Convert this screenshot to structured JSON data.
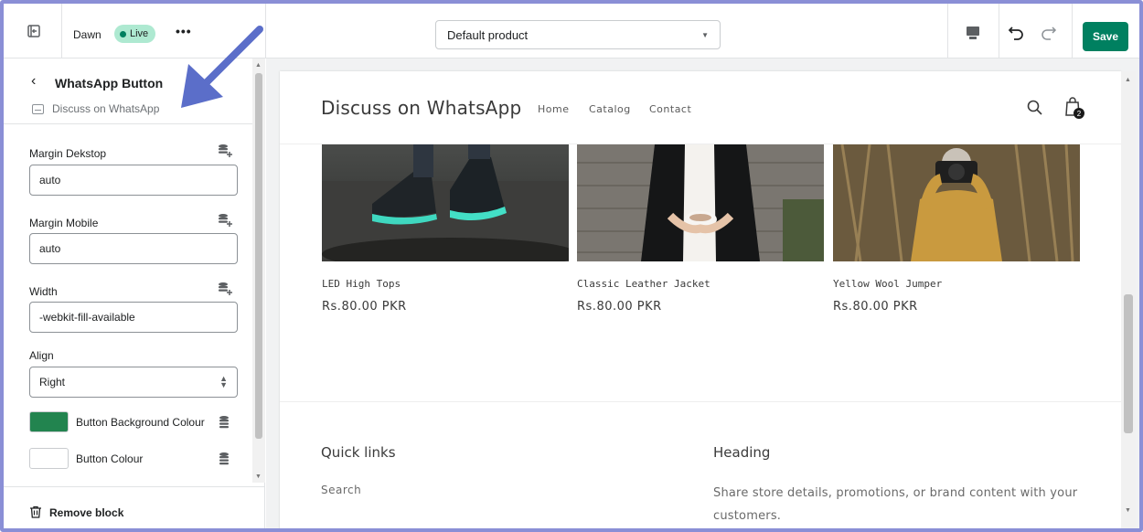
{
  "topbar": {
    "theme_name": "Dawn",
    "status_badge": "Live",
    "more_label": "•••",
    "template_select": "Default product",
    "save_label": "Save"
  },
  "sidebar": {
    "block_title": "WhatsApp Button",
    "block_subtitle": "Discuss on WhatsApp",
    "fields": {
      "margin_desktop": {
        "label": "Margin Dekstop",
        "value": "auto"
      },
      "margin_mobile": {
        "label": "Margin Mobile",
        "value": "auto"
      },
      "width": {
        "label": "Width",
        "value": "-webkit-fill-available"
      },
      "align": {
        "label": "Align",
        "value": "Right"
      },
      "button_background_colour": {
        "label": "Button Background Colour",
        "color": "#22844f"
      },
      "button_colour": {
        "label": "Button Colour",
        "color": "#ffffff"
      }
    },
    "remove_label": "Remove block"
  },
  "preview": {
    "store_name": "Discuss on WhatsApp",
    "nav": [
      "Home",
      "Catalog",
      "Contact"
    ],
    "cart_count": "2",
    "products": [
      {
        "title": "LED High Tops",
        "price": "Rs.80.00 PKR"
      },
      {
        "title": "Classic Leather Jacket",
        "price": "Rs.80.00 PKR"
      },
      {
        "title": "Yellow Wool Jumper",
        "price": "Rs.80.00 PKR"
      }
    ],
    "footer": {
      "quick_links_heading": "Quick links",
      "quick_links": [
        "Search"
      ],
      "heading": "Heading",
      "text": "Share store details, promotions, or brand content with your customers."
    }
  },
  "colors": {
    "accent_green": "#008060",
    "live_badge_bg": "#aee9d1",
    "annotation_arrow": "#5b6ec9"
  }
}
